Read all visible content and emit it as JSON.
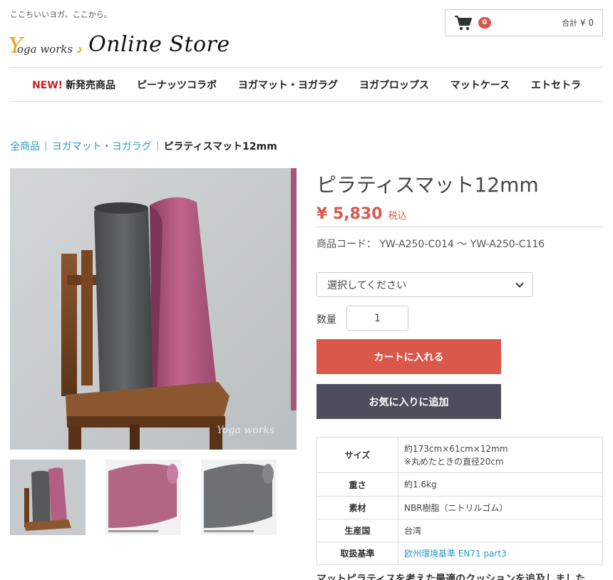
{
  "header": {
    "tagline": "ここちいいヨガ、ここから。",
    "logo_yoga": "oga works",
    "logo_y": "Y",
    "logo_store": "Online Store",
    "cart_count": "0",
    "cart_total_label": "合計",
    "cart_total_value": "¥ 0"
  },
  "nav": {
    "new_label": "NEW!",
    "items": [
      "新発売商品",
      "ピーナッツコラボ",
      "ヨガマット・ヨガラグ",
      "ヨガプロップス",
      "マットケース",
      "エトセトラ"
    ]
  },
  "breadcrumb": {
    "items": [
      "全商品",
      "ヨガマット・ヨガラグ"
    ],
    "separator": "|",
    "current": "ピラティスマット12mm"
  },
  "product": {
    "title": "ピラティスマット12mm",
    "price": "¥ 5,830",
    "tax_label": "税込",
    "code": "商品コード： YW-A250-C014 〜 YW-A250-C116",
    "select_placeholder": "選択してください",
    "qty_label": "数量",
    "qty_value": "1",
    "add_to_cart": "カートに入れる",
    "add_to_favorites": "お気に入りに追加",
    "photo_watermark": "Yoga works"
  },
  "specs": [
    {
      "label": "サイズ",
      "value": "約173cm×61cm×12mm",
      "value2": "※丸めたときの直径20cm"
    },
    {
      "label": "重さ",
      "value": "約1.6kg"
    },
    {
      "label": "素材",
      "value": "NBR樹脂（ニトリルゴム）"
    },
    {
      "label": "生産国",
      "value": "台湾"
    },
    {
      "label": "取扱基準",
      "value": "欧州環境基準 EN71 part3"
    }
  ],
  "description": "マットピラティスを考えた最適のクッションを追及しました",
  "colors": {
    "accent": "#d9584a",
    "dark_button": "#4d4d5c",
    "link": "#2a9ac8",
    "mat_pink": "#b0577f",
    "mat_gray": "#595e60"
  }
}
